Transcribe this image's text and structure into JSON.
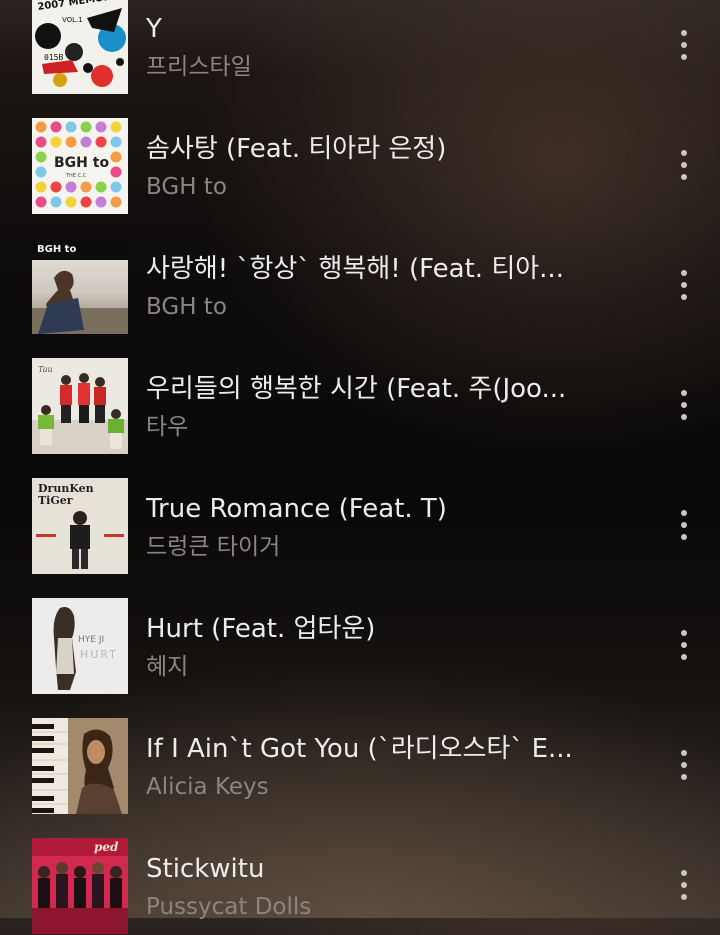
{
  "tracks": [
    {
      "title": "Y",
      "artist": "프리스타일",
      "cover_icon": "album-cover-2007-memories"
    },
    {
      "title": "솜사탕 (Feat. 티아라 은정)",
      "artist": "BGH to",
      "cover_icon": "album-cover-bgh-to-dots"
    },
    {
      "title": "사랑해! `항상` 행복해! (Feat. 티아...",
      "artist": "BGH to",
      "cover_icon": "album-cover-bgh-to-beach"
    },
    {
      "title": "우리들의 행복한 시간 (Feat. 주(Joo...",
      "artist": "타우",
      "cover_icon": "album-cover-group-photo"
    },
    {
      "title": "True Romance (Feat. T)",
      "artist": "드렁큰 타이거",
      "cover_icon": "album-cover-drunken-tiger"
    },
    {
      "title": "Hurt (Feat. 업타운)",
      "artist": "혜지",
      "cover_icon": "album-cover-hye-ji-hurt"
    },
    {
      "title": "If I Ain`t Got You (`라디오스타` E...",
      "artist": "Alicia Keys",
      "cover_icon": "album-cover-alicia-keys"
    },
    {
      "title": "Stickwitu",
      "artist": "Pussycat Dolls",
      "cover_icon": "album-cover-pussycat-dolls"
    }
  ],
  "covers": {
    "y": {
      "line1": "2007 MEMORIES",
      "line2": "VOL.1",
      "code": "015B"
    },
    "dots": {
      "logo": "BGH to",
      "sub": "THE C.C"
    },
    "beach": {
      "logo": "BGH to"
    },
    "drunken": {
      "line1": "DrunKen",
      "line2": "TiGer"
    },
    "hyeji": {
      "name": "HYE JI",
      "word": "HURT"
    },
    "pcd": {
      "name": "ped"
    }
  },
  "icons": {
    "more": "vertical-ellipsis-icon"
  },
  "colors": {
    "title_text": "#ececec",
    "artist_text": "#8a8582",
    "icon": "#c9c6c4"
  }
}
